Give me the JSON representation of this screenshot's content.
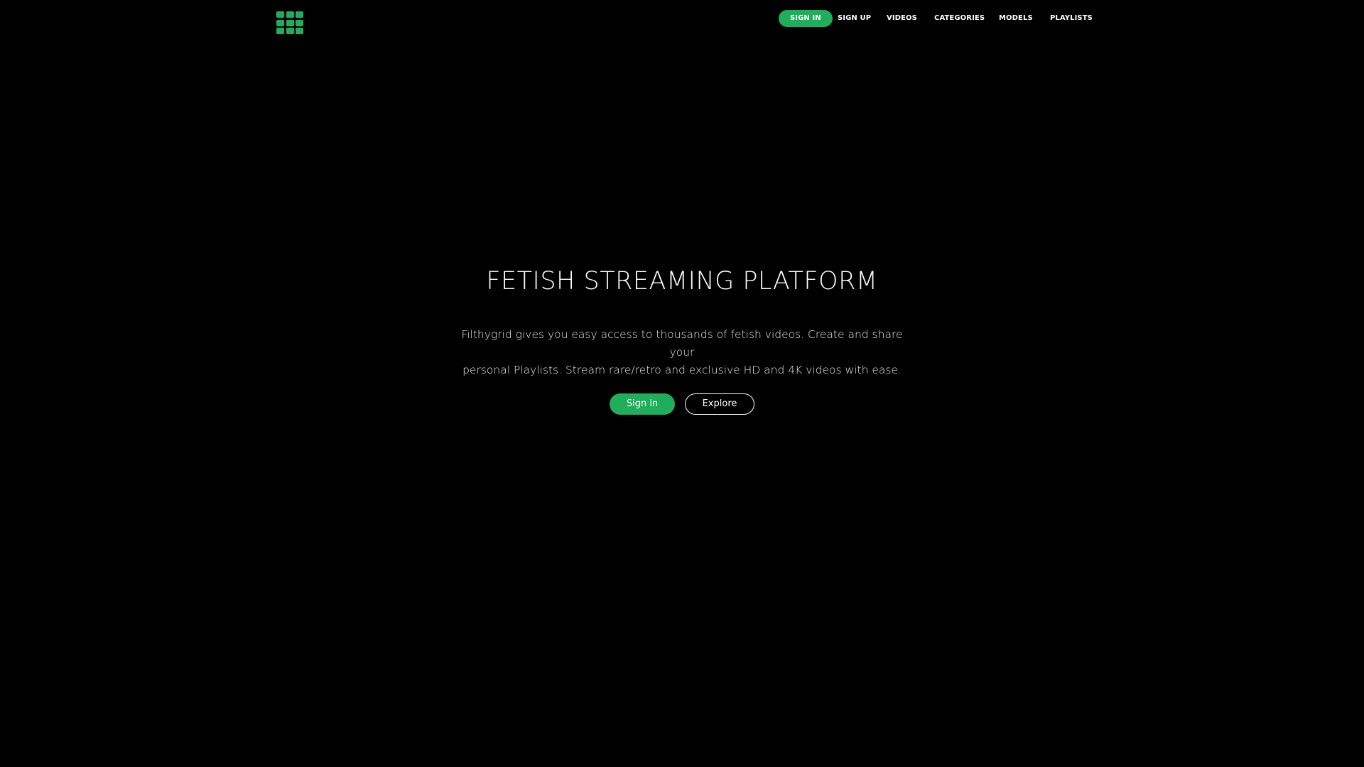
{
  "header": {
    "logo_icon": "grid-icon",
    "brand_color": "#1fae5b",
    "nav": {
      "sign_in": "SIGN IN",
      "sign_up": "SIGN UP",
      "videos": "VIDEOS",
      "categories": "CATEGORIES",
      "models": "MODELS",
      "playlists": "PLAYLISTS"
    }
  },
  "hero": {
    "title": "FETISH STREAMING PLATFORM",
    "description_line1": "Filthygrid gives you easy access to thousands of fetish videos. Create and share your",
    "description_line2": "personal Playlists. Stream rare/retro and exclusive HD and 4K videos with ease.",
    "primary_button": "Sign in",
    "secondary_button": "Explore"
  }
}
